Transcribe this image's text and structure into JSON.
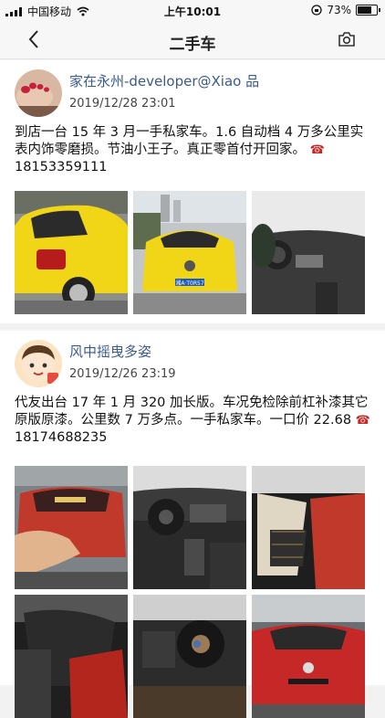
{
  "status": {
    "carrier": "中国移动",
    "time": "上午10:01",
    "battery": "73%",
    "battery_level": 0.73
  },
  "nav": {
    "title": "二手车"
  },
  "posts": [
    {
      "username": "家在永州-developer@Xiao 品",
      "time": "2019/12/28 23:01",
      "content": "到店一台 15 年 3 月一手私家车。1.6 自动档 4 万多公里实表内饰零磨损。节油小王子。真正零首付开回家。",
      "phone": "18153359111",
      "plate": "湘A·T0R57"
    },
    {
      "username": "风中摇曳多姿",
      "time": "2019/12/26 23:19",
      "content": "代友出台 17 年 1 月 320 加长版。车况免检除前杠补漆其它原版原漆。公里数 7 万多点。一手私家车。一口价 22.68",
      "phone": "18174688235"
    }
  ]
}
